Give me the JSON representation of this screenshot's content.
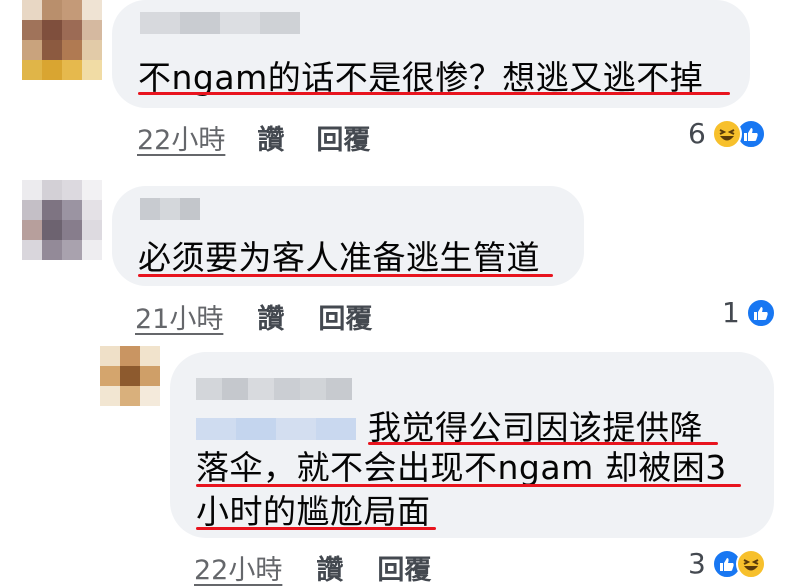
{
  "comments": [
    {
      "text_line1": "不ngam的话不是很惨？想逃又逃不掉",
      "time": "22小時",
      "like_label": "讚",
      "reply_label": "回覆",
      "reaction_count": "6",
      "reactions": [
        "haha-icon",
        "like-icon"
      ]
    },
    {
      "text_line1": "必须要为客人准备逃生管道",
      "time": "21小時",
      "like_label": "讚",
      "reply_label": "回覆",
      "reaction_count": "1",
      "reactions": [
        "like-icon"
      ]
    },
    {
      "text_line1": "我觉得公司因该提供降",
      "text_line2": "落伞，就不会出现不ngam 却被困3",
      "text_line3": "小时的尴尬局面",
      "time": "22小時",
      "like_label": "讚",
      "reply_label": "回覆",
      "reaction_count": "3",
      "reactions": [
        "like-icon",
        "haha-icon"
      ]
    }
  ],
  "colors": {
    "bubble": "#f0f2f5",
    "underline_annotation": "#e8141e",
    "like_blue": "#1877f2",
    "haha_yellow": "#f7c02c",
    "meta_gray": "#65676b"
  }
}
